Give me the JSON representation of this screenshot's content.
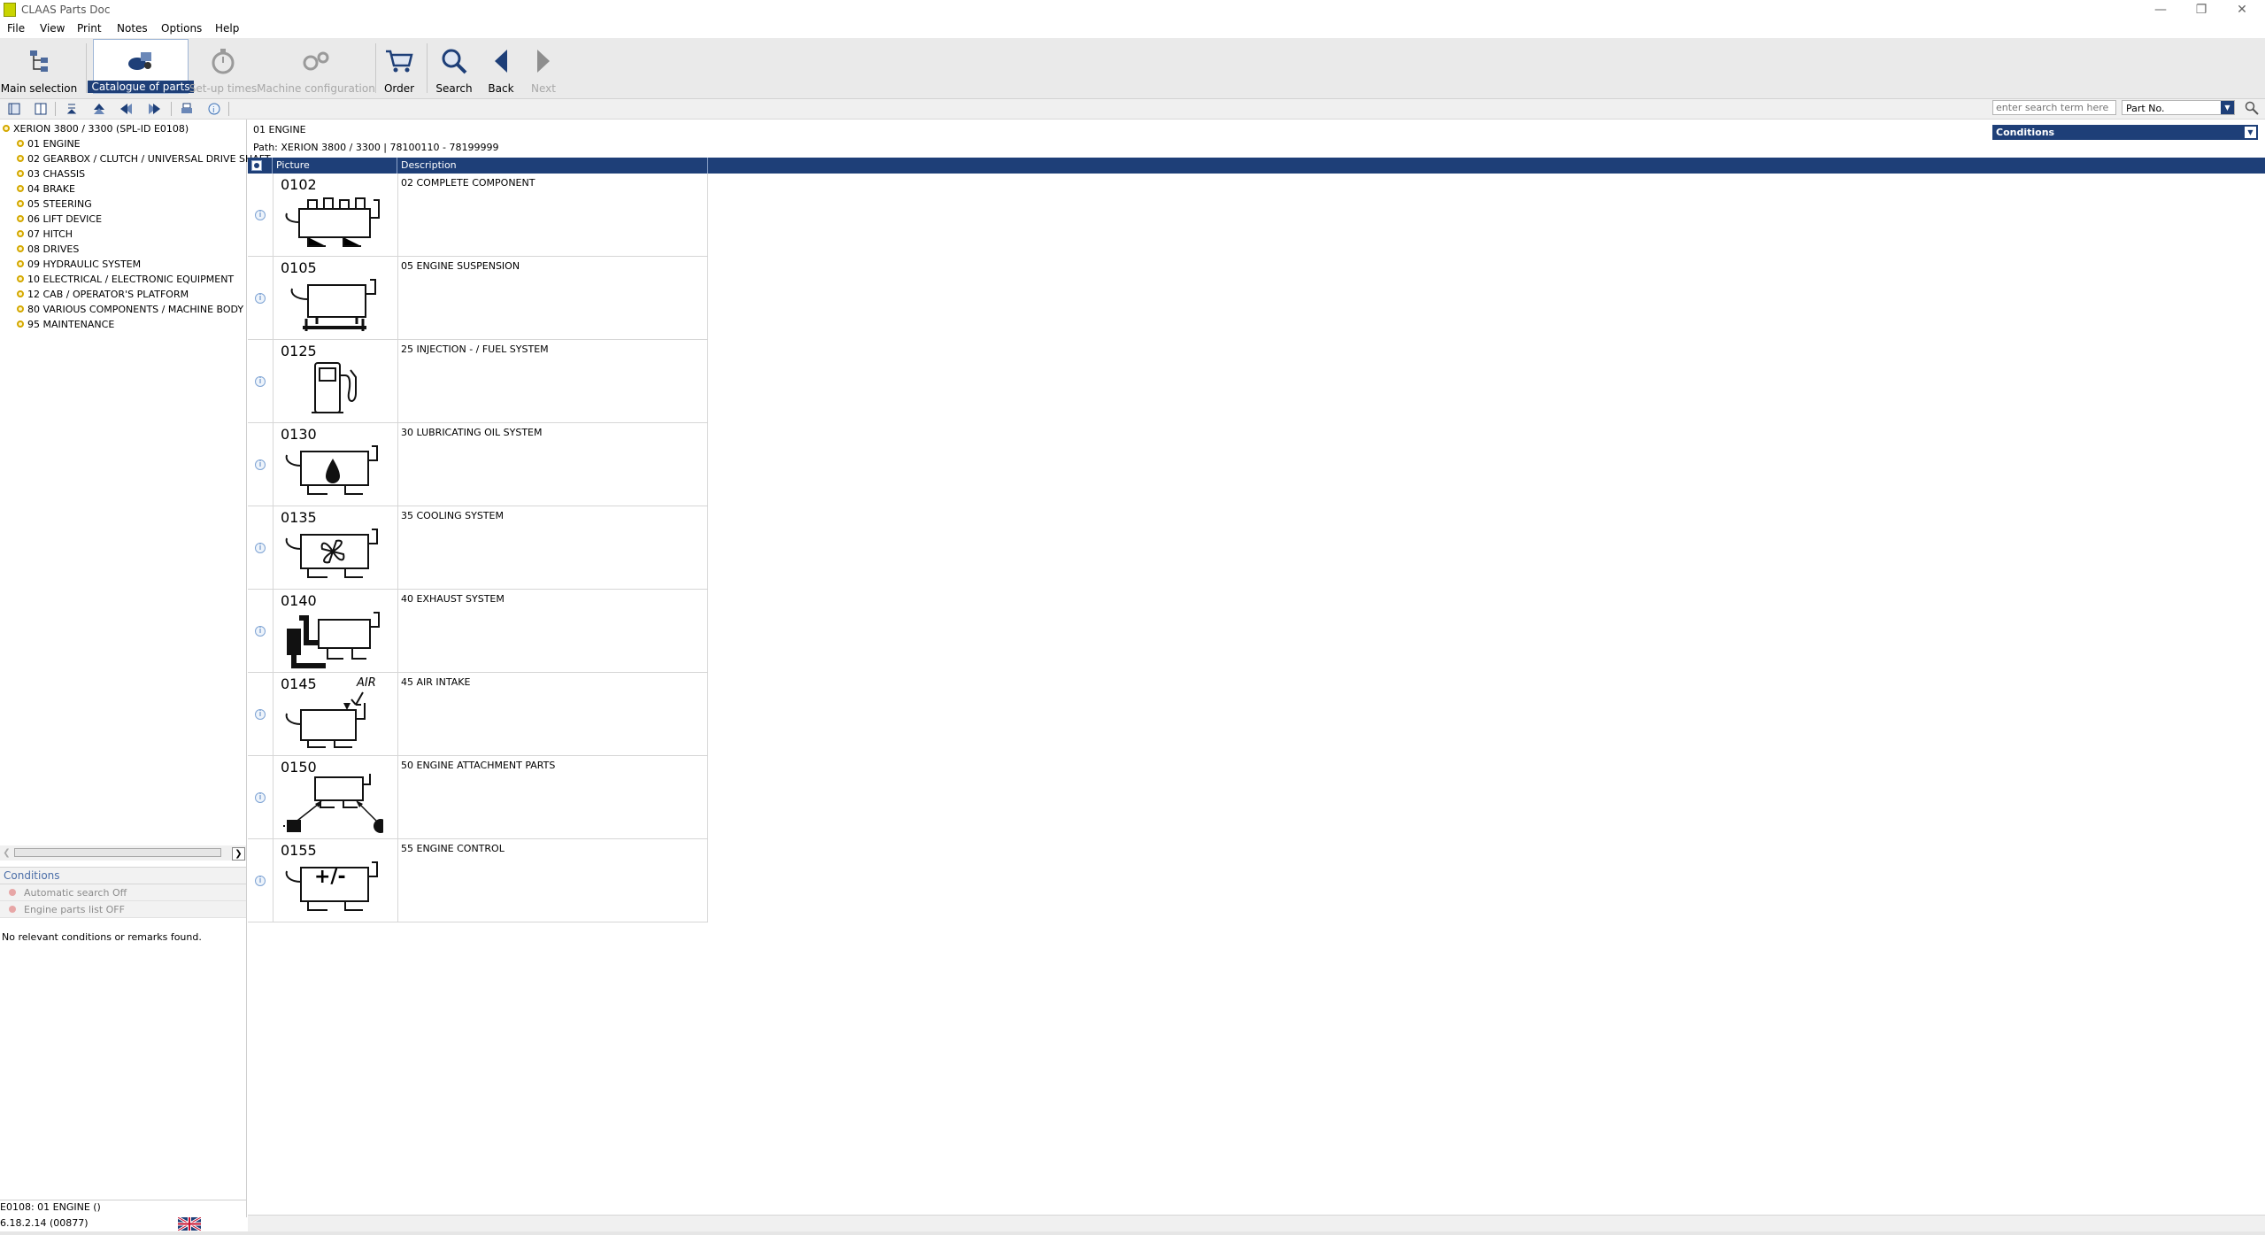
{
  "window": {
    "title": "CLAAS Parts Doc"
  },
  "menu": [
    "File",
    "View",
    "Print",
    "Notes",
    "Options",
    "Help"
  ],
  "toolbar": {
    "main_selection": "Main selection",
    "catalogue_of_parts": "Catalogue of parts",
    "setup_times": "Set-up times",
    "machine_configuration": "Machine configuration",
    "order": "Order",
    "search": "Search",
    "back": "Back",
    "next": "Next"
  },
  "search": {
    "placeholder": "enter search term here",
    "type": "Part No."
  },
  "tree": {
    "root": "XERION 3800 / 3300   (SPL-ID E0108)",
    "items": [
      "01 ENGINE",
      "02 GEARBOX / CLUTCH / UNIVERSAL DRIVE SHAFT",
      "03 CHASSIS",
      "04 BRAKE",
      "05 STEERING",
      "06 LIFT DEVICE",
      "07 HITCH",
      "08 DRIVES",
      "09 HYDRAULIC SYSTEM",
      "10 ELECTRICAL / ELECTRONIC EQUIPMENT",
      "12 CAB / OPERATOR'S PLATFORM",
      "80 VARIOUS COMPONENTS / MACHINE BODY",
      "95 MAINTENANCE"
    ]
  },
  "conditions": {
    "header": "Conditions",
    "rows": [
      "Automatic search Off",
      "Engine parts list OFF"
    ],
    "message": "No relevant conditions or remarks found."
  },
  "main": {
    "title": "01 ENGINE",
    "path": "Path: XERION 3800 / 3300 | 78100110 - 78199999",
    "conditions_label": "Conditions",
    "columns": {
      "picture": "Picture",
      "description": "Description"
    },
    "rows": [
      {
        "code": "0102",
        "description": "02 COMPLETE COMPONENT",
        "icon": "complete-component-icon"
      },
      {
        "code": "0105",
        "description": "05 ENGINE SUSPENSION",
        "icon": "engine-suspension-icon"
      },
      {
        "code": "0125",
        "description": "25 INJECTION - / FUEL SYSTEM",
        "icon": "fuel-pump-icon"
      },
      {
        "code": "0130",
        "description": "30 LUBRICATING OIL SYSTEM",
        "icon": "oil-drop-icon"
      },
      {
        "code": "0135",
        "description": "35 COOLING SYSTEM",
        "icon": "fan-icon"
      },
      {
        "code": "0140",
        "description": "40 EXHAUST SYSTEM",
        "icon": "exhaust-icon"
      },
      {
        "code": "0145",
        "description": "45 AIR INTAKE",
        "icon": "air-intake-icon",
        "extra": "AIR"
      },
      {
        "code": "0150",
        "description": "50 ENGINE ATTACHMENT PARTS",
        "icon": "attachment-parts-icon"
      },
      {
        "code": "0155",
        "description": "55 ENGINE CONTROL",
        "icon": "engine-control-icon",
        "extra": "+/-"
      }
    ]
  },
  "status": {
    "line1": "E0108: 01 ENGINE ()",
    "line2": "6.18.2.14 (00877)"
  },
  "colors": {
    "accent": "#1e3f78",
    "bullet": "#d4a800"
  }
}
